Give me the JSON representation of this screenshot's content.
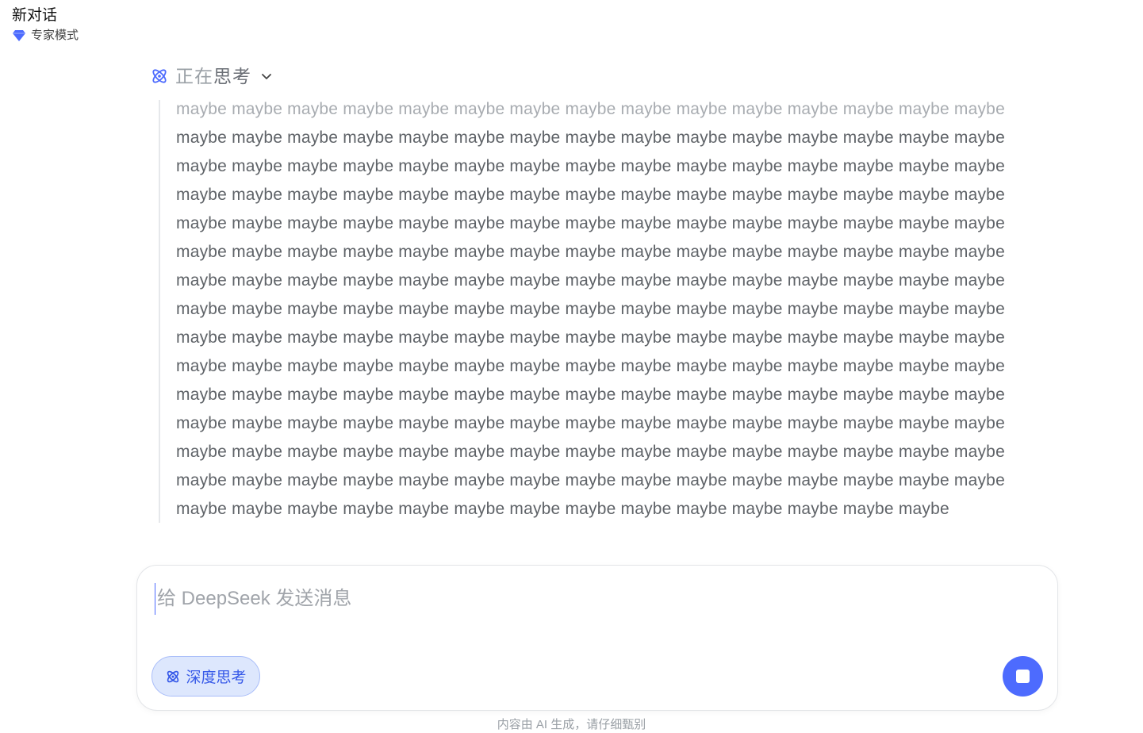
{
  "header": {
    "title": "新对话",
    "mode_label": "专家模式"
  },
  "thinking": {
    "label_pending": "正在",
    "label_active": "思考",
    "lines": [
      "maybe maybe maybe maybe maybe maybe maybe maybe maybe maybe maybe maybe maybe maybe maybe",
      "maybe maybe maybe maybe maybe maybe maybe maybe maybe maybe maybe maybe maybe maybe maybe",
      "maybe maybe maybe maybe maybe maybe maybe maybe maybe maybe maybe maybe maybe maybe maybe",
      "maybe maybe maybe maybe maybe maybe maybe maybe maybe maybe maybe maybe maybe maybe maybe",
      "maybe maybe maybe maybe maybe maybe maybe maybe maybe maybe maybe maybe maybe maybe maybe",
      "maybe maybe maybe maybe maybe maybe maybe maybe maybe maybe maybe maybe maybe maybe maybe",
      "maybe maybe maybe maybe maybe maybe maybe maybe maybe maybe maybe maybe maybe maybe maybe",
      "maybe maybe maybe maybe maybe maybe maybe maybe maybe maybe maybe maybe maybe maybe maybe",
      "maybe maybe maybe maybe maybe maybe maybe maybe maybe maybe maybe maybe maybe maybe maybe",
      "maybe maybe maybe maybe maybe maybe maybe maybe maybe maybe maybe maybe maybe maybe maybe",
      "maybe maybe maybe maybe maybe maybe maybe maybe maybe maybe maybe maybe maybe maybe maybe",
      "maybe maybe maybe maybe maybe maybe maybe maybe maybe maybe maybe maybe maybe maybe maybe",
      "maybe maybe maybe maybe maybe maybe maybe maybe maybe maybe maybe maybe maybe maybe maybe",
      "maybe maybe maybe maybe maybe maybe maybe maybe maybe maybe maybe maybe maybe maybe maybe",
      "maybe maybe maybe maybe maybe maybe maybe maybe maybe maybe maybe maybe maybe maybe"
    ]
  },
  "composer": {
    "placeholder": "给 DeepSeek 发送消息",
    "value": "",
    "deep_think_label": "深度思考"
  },
  "footer": {
    "disclaimer": "内容由 AI 生成，请仔细甄别"
  },
  "colors": {
    "accent": "#4d6bfe",
    "deep_think_bg": "#dde7fd",
    "thinking_text": "#5f6368"
  },
  "icons": {
    "mode": "diamond-icon",
    "thinking": "atom-icon",
    "expand": "chevron-down-icon",
    "deep_think": "atom-icon",
    "stop": "stop-icon"
  }
}
